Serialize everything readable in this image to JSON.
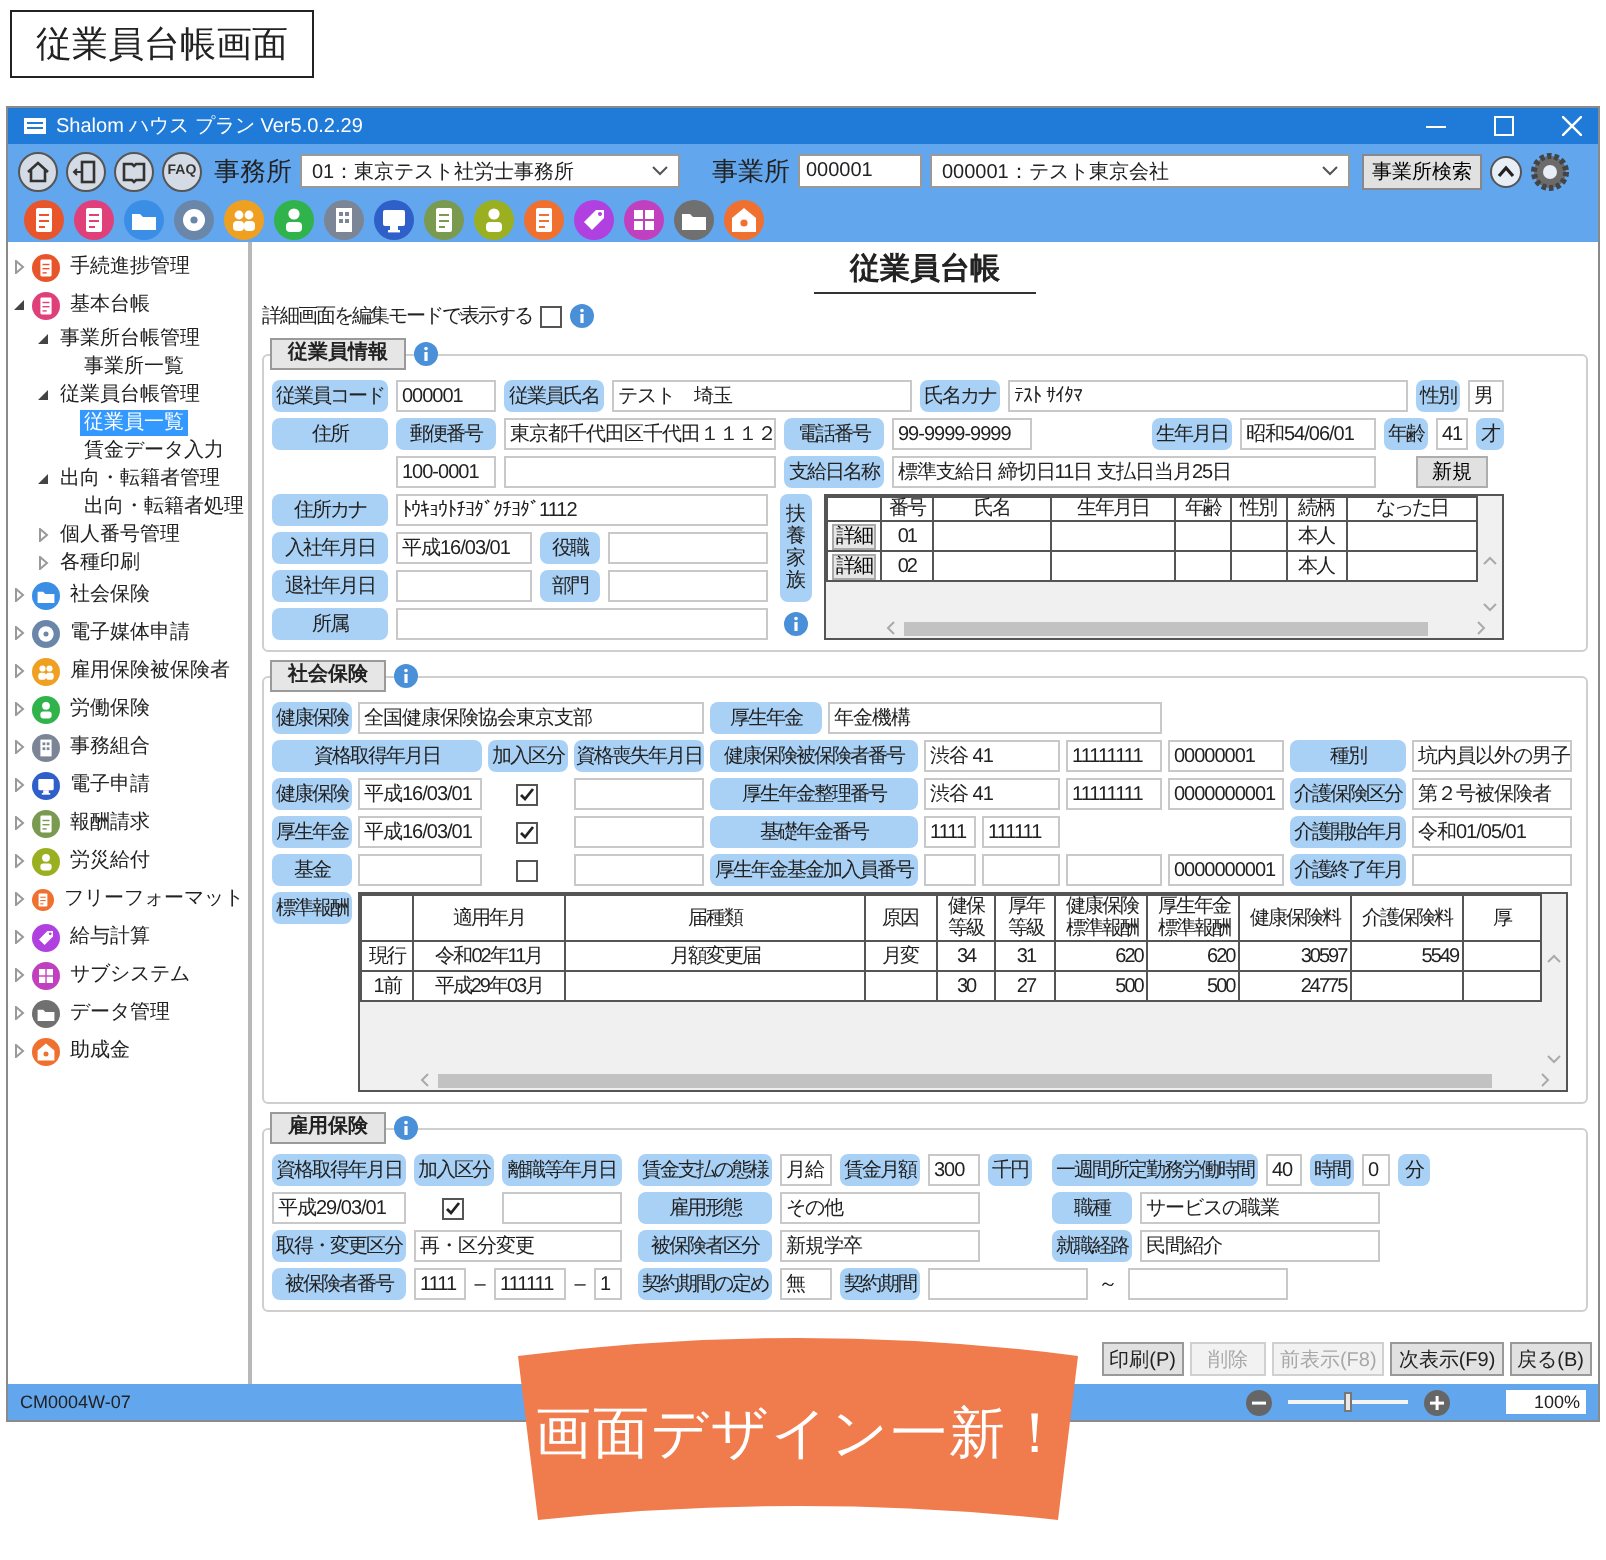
{
  "caption": "従業員台帳画面",
  "window": {
    "title": "Shalom ハウス プラン Ver5.0.2.29"
  },
  "toolbar": {
    "help_button": "FAQ",
    "office_label": "事務所",
    "office_value": "01：東京テスト社労士事務所",
    "site_label": "事業所",
    "site_code": "000001",
    "site_value": "000001：テスト東京会社",
    "search_button": "事業所検索"
  },
  "sidebar": {
    "items": [
      {
        "label": "手続進捗管理",
        "expanded": false,
        "selected": false
      },
      {
        "label": "基本台帳",
        "expanded": true,
        "selected": false,
        "children": [
          {
            "label": "事業所台帳管理",
            "expanded": true,
            "selected": false,
            "children": [
              {
                "label": "事業所一覧",
                "selected": false
              }
            ]
          },
          {
            "label": "従業員台帳管理",
            "expanded": true,
            "selected": false,
            "children": [
              {
                "label": "従業員一覧",
                "selected": true
              },
              {
                "label": "賃金データ入力",
                "selected": false
              }
            ]
          },
          {
            "label": "出向・転籍者管理",
            "expanded": true,
            "selected": false,
            "children": [
              {
                "label": "出向・転籍者処理",
                "selected": false
              }
            ]
          },
          {
            "label": "個人番号管理",
            "expanded": false,
            "selected": false
          },
          {
            "label": "各種印刷",
            "expanded": false,
            "selected": false
          }
        ]
      },
      {
        "label": "社会保険",
        "expanded": false,
        "selected": false
      },
      {
        "label": "電子媒体申請",
        "expanded": false,
        "selected": false
      },
      {
        "label": "雇用保険被保険者",
        "expanded": false,
        "selected": false
      },
      {
        "label": "労働保険",
        "expanded": false,
        "selected": false
      },
      {
        "label": "事務組合",
        "expanded": false,
        "selected": false
      },
      {
        "label": "電子申請",
        "expanded": false,
        "selected": false
      },
      {
        "label": "報酬請求",
        "expanded": false,
        "selected": false
      },
      {
        "label": "労災給付",
        "expanded": false,
        "selected": false
      },
      {
        "label": "フリーフォーマット",
        "expanded": false,
        "selected": false
      },
      {
        "label": "給与計算",
        "expanded": false,
        "selected": false
      },
      {
        "label": "サブシステム",
        "expanded": false,
        "selected": false
      },
      {
        "label": "データ管理",
        "expanded": false,
        "selected": false
      },
      {
        "label": "助成金",
        "expanded": false,
        "selected": false
      }
    ]
  },
  "page_title": "従業員台帳",
  "edit_mode": {
    "label": "詳細画面を編集モードで表示する",
    "checked": false
  },
  "sections": [
    {
      "title": "従業員情報",
      "items": [
        {
          "kind": "label",
          "text": "従業員コード"
        },
        {
          "kind": "field",
          "value": "000001"
        },
        {
          "kind": "label",
          "text": "従業員氏名"
        },
        {
          "kind": "field",
          "value": "テスト　埼玉"
        },
        {
          "kind": "label",
          "text": "氏名カナ"
        },
        {
          "kind": "field",
          "value": "ﾃｽﾄ ｻｲﾀﾏ"
        },
        {
          "kind": "label",
          "text": "性別"
        },
        {
          "kind": "field",
          "value": "男"
        },
        {
          "kind": "label",
          "text": "住所"
        },
        {
          "kind": "label",
          "text": "郵便番号"
        },
        {
          "kind": "field",
          "value": "東京都千代田区千代田１１１２"
        },
        {
          "kind": "label",
          "text": "電話番号"
        },
        {
          "kind": "field",
          "value": "99-9999-9999"
        },
        {
          "kind": "label",
          "text": "生年月日"
        },
        {
          "kind": "field",
          "value": "昭和54/06/01"
        },
        {
          "kind": "label",
          "text": "年齢"
        },
        {
          "kind": "field",
          "value": "41"
        },
        {
          "kind": "label",
          "text": "才"
        },
        {
          "kind": "field",
          "value": "100-0001"
        },
        {
          "kind": "field"
        },
        {
          "kind": "label",
          "text": "支給日名称"
        },
        {
          "kind": "field",
          "value": "標準支給日 締切日11日 支払日当月25日"
        },
        {
          "kind": "button",
          "text": "新規"
        },
        {
          "kind": "label",
          "text": "住所カナ"
        },
        {
          "kind": "field",
          "value": "ﾄｳｷｮｳﾄﾁﾖﾀﾞｸﾁﾖﾀﾞ1112"
        },
        {
          "kind": "label",
          "text": "入社年月日"
        },
        {
          "kind": "field",
          "value": "平成16/03/01"
        },
        {
          "kind": "label",
          "text": "役職"
        },
        {
          "kind": "field"
        },
        {
          "kind": "label",
          "text": "退社年月日"
        },
        {
          "kind": "field"
        },
        {
          "kind": "label",
          "text": "部門"
        },
        {
          "kind": "field"
        },
        {
          "kind": "label",
          "text": "所属"
        },
        {
          "kind": "field"
        },
        {
          "kind": "vlabel",
          "text": "扶養家族"
        },
        {
          "kind": "table",
          "columns": [
            "番号",
            "氏名",
            "生年月日",
            "年齢",
            "性別",
            "続柄",
            "なった日"
          ],
          "rows": [
            {
              "button": "詳細",
              "cells": [
                "01",
                null,
                null,
                null,
                null,
                "本人",
                null
              ]
            },
            {
              "button": "詳細",
              "cells": [
                "02",
                null,
                null,
                null,
                null,
                "本人",
                null
              ]
            }
          ]
        }
      ]
    },
    {
      "title": "社会保険",
      "items": [
        {
          "kind": "label",
          "text": "健康保険"
        },
        {
          "kind": "field",
          "value": "全国健康保険協会東京支部"
        },
        {
          "kind": "label",
          "text": "厚生年金"
        },
        {
          "kind": "field",
          "value": "年金機構"
        },
        {
          "kind": "label",
          "text": "資格取得年月日"
        },
        {
          "kind": "label",
          "text": "加入区分"
        },
        {
          "kind": "label",
          "text": "資格喪失年月日"
        },
        {
          "kind": "label",
          "text": "健康保険被保険者番号"
        },
        {
          "kind": "field",
          "value": "渋谷 41"
        },
        {
          "kind": "field",
          "value": "11111111"
        },
        {
          "kind": "field",
          "value": "00000001"
        },
        {
          "kind": "label",
          "text": "種別"
        },
        {
          "kind": "field",
          "value": "坑内員以外の男子"
        },
        {
          "kind": "label",
          "text": "健康保険"
        },
        {
          "kind": "field",
          "value": "平成16/03/01"
        },
        {
          "kind": "check",
          "checked": true
        },
        {
          "kind": "field"
        },
        {
          "kind": "label",
          "text": "厚生年金整理番号"
        },
        {
          "kind": "field",
          "value": "渋谷 41"
        },
        {
          "kind": "field",
          "value": "11111111"
        },
        {
          "kind": "field",
          "value": "0000000001"
        },
        {
          "kind": "label",
          "text": "介護保険区分"
        },
        {
          "kind": "field",
          "value": "第２号被保険者"
        },
        {
          "kind": "label",
          "text": "厚生年金"
        },
        {
          "kind": "field",
          "value": "平成16/03/01"
        },
        {
          "kind": "check",
          "checked": true
        },
        {
          "kind": "field"
        },
        {
          "kind": "label",
          "text": "基礎年金番号"
        },
        {
          "kind": "field",
          "value": "1111"
        },
        {
          "kind": "field",
          "value": "111111"
        },
        {
          "kind": "label",
          "text": "介護開始年月"
        },
        {
          "kind": "field",
          "value": "令和01/05/01"
        },
        {
          "kind": "label",
          "text": "基金"
        },
        {
          "kind": "field"
        },
        {
          "kind": "check",
          "checked": false
        },
        {
          "kind": "field"
        },
        {
          "kind": "label",
          "text": "厚生年金基金加入員番号"
        },
        {
          "kind": "field"
        },
        {
          "kind": "field"
        },
        {
          "kind": "field"
        },
        {
          "kind": "field",
          "value": "0000000001"
        },
        {
          "kind": "label",
          "text": "介護終了年月"
        },
        {
          "kind": "field"
        },
        {
          "kind": "label",
          "text": "標準報酬"
        },
        {
          "kind": "table",
          "columns": [
            null,
            "適用年月",
            "届種類",
            "原因",
            "健保等級",
            "厚年等級",
            "健康保険標準報酬",
            "厚生年金標準報酬",
            "健康保険料",
            "介護保険料",
            "厚"
          ],
          "rows": [
            {
              "cells": [
                "現行",
                "令和02年11月",
                "月額変更届",
                "月変",
                "34",
                "31",
                "620",
                "620",
                "30597",
                "5549",
                null
              ]
            },
            {
              "cells": [
                "1前",
                "平成29年03月",
                null,
                null,
                "30",
                "27",
                "500",
                "500",
                "24775",
                null,
                null
              ]
            }
          ]
        }
      ]
    },
    {
      "title": "雇用保険",
      "items": [
        {
          "kind": "label",
          "text": "資格取得年月日"
        },
        {
          "kind": "label",
          "text": "加入区分"
        },
        {
          "kind": "label",
          "text": "離職等年月日"
        },
        {
          "kind": "label",
          "text": "賃金支払の態様"
        },
        {
          "kind": "field",
          "value": "月給"
        },
        {
          "kind": "label",
          "text": "賃金月額"
        },
        {
          "kind": "field",
          "value": "300"
        },
        {
          "kind": "label",
          "text": "千円"
        },
        {
          "kind": "label",
          "text": "一週間所定勤務労働時間"
        },
        {
          "kind": "field",
          "value": "40"
        },
        {
          "kind": "label",
          "text": "時間"
        },
        {
          "kind": "field",
          "value": "0"
        },
        {
          "kind": "label",
          "text": "分"
        },
        {
          "kind": "field",
          "value": "平成29/03/01"
        },
        {
          "kind": "check",
          "checked": true
        },
        {
          "kind": "field"
        },
        {
          "kind": "label",
          "text": "雇用形態"
        },
        {
          "kind": "field",
          "value": "その他"
        },
        {
          "kind": "label",
          "text": "職種"
        },
        {
          "kind": "field",
          "value": "サービスの職業"
        },
        {
          "kind": "label",
          "text": "取得・変更区分"
        },
        {
          "kind": "field",
          "value": "再・区分変更"
        },
        {
          "kind": "label",
          "text": "被保険者区分"
        },
        {
          "kind": "field",
          "value": "新規学卒"
        },
        {
          "kind": "label",
          "text": "就職経路"
        },
        {
          "kind": "field",
          "value": "民間紹介"
        },
        {
          "kind": "label",
          "text": "被保険者番号"
        },
        {
          "kind": "field",
          "value": "1111"
        },
        {
          "kind": "text",
          "text": "–"
        },
        {
          "kind": "field",
          "value": "111111"
        },
        {
          "kind": "text",
          "text": "–"
        },
        {
          "kind": "field",
          "value": "1"
        },
        {
          "kind": "label",
          "text": "契約期間の定め"
        },
        {
          "kind": "field",
          "value": "無"
        },
        {
          "kind": "label",
          "text": "契約期間"
        },
        {
          "kind": "field"
        },
        {
          "kind": "text",
          "text": "～"
        },
        {
          "kind": "field"
        }
      ]
    }
  ],
  "buttons": [
    {
      "label": "印刷(P)",
      "disabled": false
    },
    {
      "label": "削除",
      "disabled": true
    },
    {
      "label": "前表示(F8)",
      "disabled": true
    },
    {
      "label": "次表示(F9)",
      "disabled": false
    },
    {
      "label": "戻る(B)",
      "disabled": false
    }
  ],
  "status_bar": {
    "code": "CM0004W-07",
    "zoom": {
      "level": 0.5,
      "reading": "100%"
    }
  },
  "banner": {
    "text": "画面デザイン一新！"
  }
}
